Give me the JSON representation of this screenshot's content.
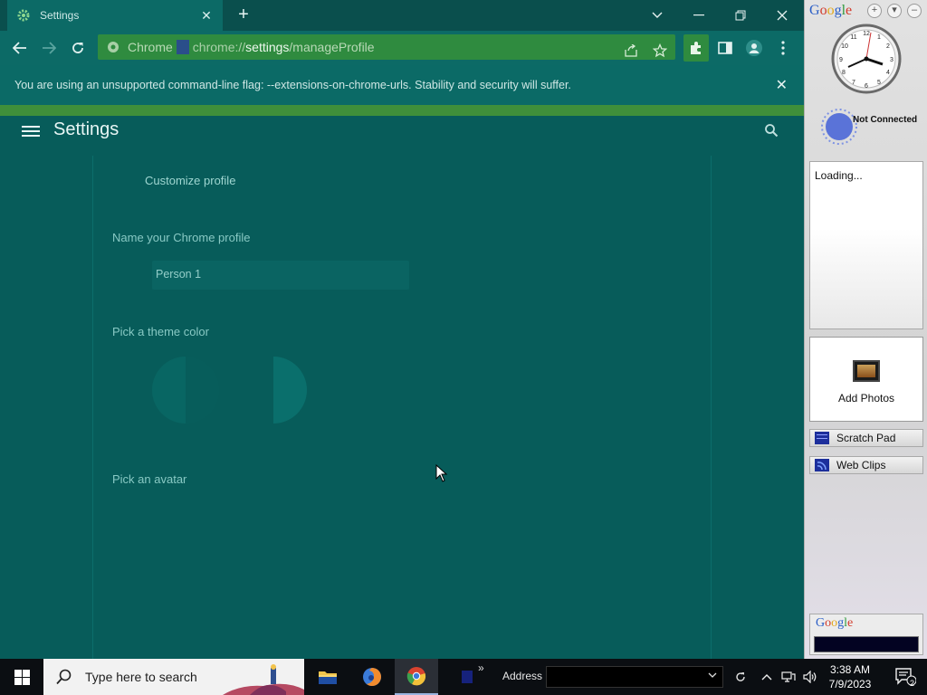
{
  "browser": {
    "tab_title": "Settings",
    "url_site": "Chrome",
    "url_scheme": "chrome://",
    "url_host": "settings",
    "url_path": "/manageProfile",
    "infobar_text": "You are using an unsupported command-line flag: --extensions-on-chrome-urls. Stability and security will suffer."
  },
  "settings": {
    "title": "Settings",
    "section_title": "Customize profile",
    "name_label": "Name your Chrome profile",
    "name_value": "Person 1",
    "theme_label": "Pick a theme color",
    "avatar_label": "Pick an avatar"
  },
  "sidebar": {
    "logo": "Google",
    "status_text": "Not Connected",
    "loading_text": "Loading...",
    "photos_label": "Add Photos",
    "items": [
      {
        "label": "Scratch Pad"
      },
      {
        "label": "Web Clips"
      }
    ],
    "search_logo": "Google"
  },
  "taskbar": {
    "search_placeholder": "Type here to search",
    "address_label": "Address",
    "time": "3:38 AM",
    "date": "7/9/2023",
    "notification_count": "2"
  },
  "colors": {
    "page_bg": "#075c5a",
    "accent_green": "#2f8b3f",
    "label_teal": "#88c9c4"
  }
}
